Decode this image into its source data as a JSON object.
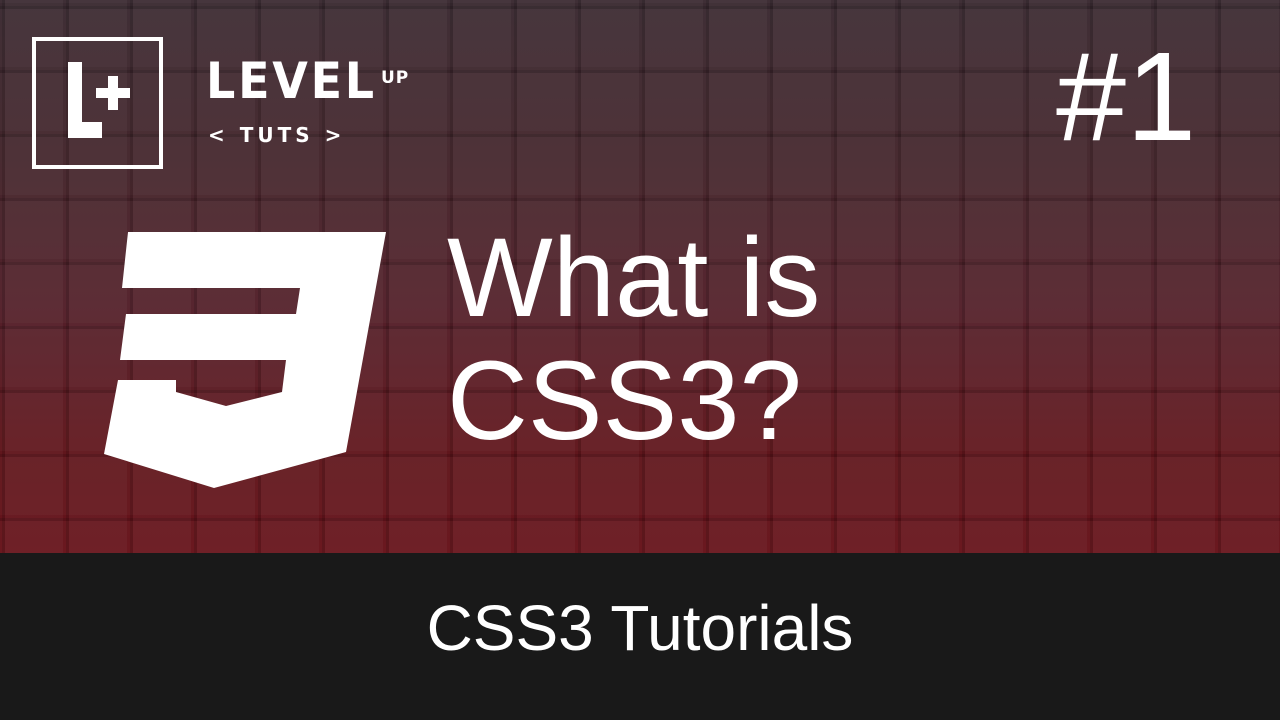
{
  "brand": {
    "logo_letters": "L+",
    "name": "LEVEL",
    "superscript": "UP",
    "tagline": "< TUTS >"
  },
  "episode": {
    "label": "#1"
  },
  "title": {
    "line1": "What is",
    "line2": "CSS3?"
  },
  "series": {
    "label": "CSS3 Tutorials"
  },
  "icons": {
    "logo": "level-up-logo-icon",
    "css3": "css3-shield-icon"
  },
  "colors": {
    "background_top": "#3a2a31",
    "background_bottom": "#66121a",
    "footer": "#191919",
    "text": "#ffffff"
  }
}
